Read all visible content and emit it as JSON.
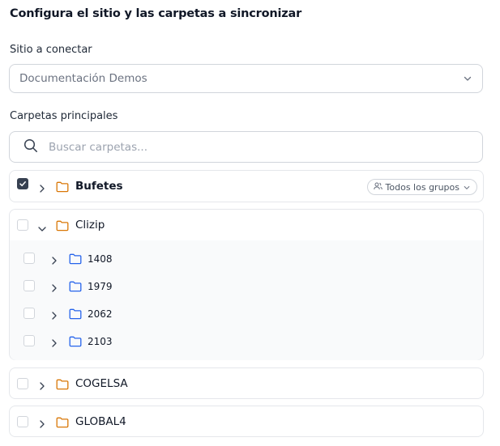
{
  "page": {
    "title": "Configura el sitio y las carpetas a sincronizar"
  },
  "site": {
    "label": "Sitio a conectar",
    "selected": "Documentación Demos",
    "icon": "chevron-down-icon"
  },
  "folders": {
    "label": "Carpetas principales",
    "search_placeholder": "Buscar carpetas...",
    "items": [
      {
        "name": "Bufetes",
        "checked": true,
        "expanded": false,
        "badge": "Todos los grupos"
      },
      {
        "name": "Clizip",
        "checked": false,
        "expanded": true,
        "children": [
          {
            "name": "1408",
            "checked": false
          },
          {
            "name": "1979",
            "checked": false
          },
          {
            "name": "2062",
            "checked": false
          },
          {
            "name": "2103",
            "checked": false
          }
        ]
      },
      {
        "name": "COGELSA",
        "checked": false,
        "expanded": false
      },
      {
        "name": "GLOBAL4",
        "checked": false,
        "expanded": false
      }
    ]
  },
  "colors": {
    "folder_top": "#d97706",
    "folder_sub": "#2563eb",
    "checkbox_checked": "#374151",
    "border": "#d1d5db"
  }
}
